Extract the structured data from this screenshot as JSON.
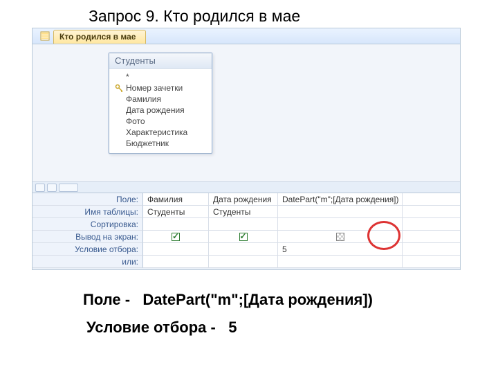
{
  "slide": {
    "title": "Запрос 9. Кто родился в мае"
  },
  "tab": {
    "label": "Кто родился в мае"
  },
  "table": {
    "title": "Студенты",
    "star": "*",
    "fields": [
      {
        "name": "Номер зачетки",
        "pk": true
      },
      {
        "name": "Фамилия",
        "pk": false
      },
      {
        "name": "Дата рождения",
        "pk": false
      },
      {
        "name": "Фото",
        "pk": false
      },
      {
        "name": "Характеристика",
        "pk": false
      },
      {
        "name": "Бюджетник",
        "pk": false
      }
    ]
  },
  "grid": {
    "labels": {
      "field": "Поле:",
      "table": "Имя таблицы:",
      "sort": "Сортировка:",
      "show": "Вывод на экран:",
      "criteria": "Условие отбора:",
      "or": "или:"
    },
    "cols": [
      {
        "field": "Фамилия",
        "table": "Студенты",
        "show": true,
        "criteria": ""
      },
      {
        "field": "Дата рождения",
        "table": "Студенты",
        "show": true,
        "criteria": ""
      },
      {
        "field": "DatePart(\"m\";[Дата рождения])",
        "table": "",
        "show": false,
        "criteria": "5"
      }
    ]
  },
  "captions": {
    "line1_a": "Поле -",
    "line1_b": "DatePart(\"m\";[Дата рождения])",
    "line2_a": "Условие отбора -",
    "line2_b": "5"
  }
}
